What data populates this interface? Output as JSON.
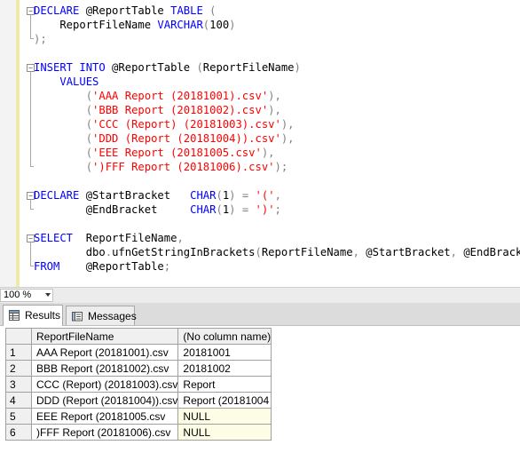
{
  "editor": {
    "lines": [
      [
        {
          "c": "kw",
          "t": "DECLARE"
        },
        {
          "c": "",
          "t": " @ReportTable "
        },
        {
          "c": "kw",
          "t": "TABLE"
        },
        {
          "c": "",
          "t": " "
        },
        {
          "c": "op",
          "t": "("
        }
      ],
      [
        {
          "c": "",
          "t": "    ReportFileName "
        },
        {
          "c": "kw",
          "t": "VARCHAR"
        },
        {
          "c": "op",
          "t": "("
        },
        {
          "c": "",
          "t": "100"
        },
        {
          "c": "op",
          "t": ")"
        }
      ],
      [
        {
          "c": "op",
          "t": ");"
        }
      ],
      [],
      [
        {
          "c": "kw",
          "t": "INSERT INTO"
        },
        {
          "c": "",
          "t": " @ReportTable "
        },
        {
          "c": "op",
          "t": "("
        },
        {
          "c": "",
          "t": "ReportFileName"
        },
        {
          "c": "op",
          "t": ")"
        }
      ],
      [
        {
          "c": "",
          "t": "    "
        },
        {
          "c": "kw",
          "t": "VALUES"
        }
      ],
      [
        {
          "c": "",
          "t": "        "
        },
        {
          "c": "op",
          "t": "("
        },
        {
          "c": "st",
          "t": "'AAA Report (20181001).csv'"
        },
        {
          "c": "op",
          "t": "),"
        }
      ],
      [
        {
          "c": "",
          "t": "        "
        },
        {
          "c": "op",
          "t": "("
        },
        {
          "c": "st",
          "t": "'BBB Report (20181002).csv'"
        },
        {
          "c": "op",
          "t": "),"
        }
      ],
      [
        {
          "c": "",
          "t": "        "
        },
        {
          "c": "op",
          "t": "("
        },
        {
          "c": "st",
          "t": "'CCC (Report) (20181003).csv'"
        },
        {
          "c": "op",
          "t": "),"
        }
      ],
      [
        {
          "c": "",
          "t": "        "
        },
        {
          "c": "op",
          "t": "("
        },
        {
          "c": "st",
          "t": "'DDD (Report (20181004)).csv'"
        },
        {
          "c": "op",
          "t": "),"
        }
      ],
      [
        {
          "c": "",
          "t": "        "
        },
        {
          "c": "op",
          "t": "("
        },
        {
          "c": "st",
          "t": "'EEE Report (20181005.csv'"
        },
        {
          "c": "op",
          "t": "),"
        }
      ],
      [
        {
          "c": "",
          "t": "        "
        },
        {
          "c": "op",
          "t": "("
        },
        {
          "c": "st",
          "t": "')FFF Report (20181006).csv'"
        },
        {
          "c": "op",
          "t": ");"
        }
      ],
      [],
      [
        {
          "c": "kw",
          "t": "DECLARE"
        },
        {
          "c": "",
          "t": " @StartBracket   "
        },
        {
          "c": "kw",
          "t": "CHAR"
        },
        {
          "c": "op",
          "t": "("
        },
        {
          "c": "",
          "t": "1"
        },
        {
          "c": "op",
          "t": ")"
        },
        {
          "c": "",
          "t": " "
        },
        {
          "c": "op",
          "t": "="
        },
        {
          "c": "",
          "t": " "
        },
        {
          "c": "st",
          "t": "'('"
        },
        {
          "c": "op",
          "t": ","
        }
      ],
      [
        {
          "c": "",
          "t": "        @EndBracket     "
        },
        {
          "c": "kw",
          "t": "CHAR"
        },
        {
          "c": "op",
          "t": "("
        },
        {
          "c": "",
          "t": "1"
        },
        {
          "c": "op",
          "t": ")"
        },
        {
          "c": "",
          "t": " "
        },
        {
          "c": "op",
          "t": "="
        },
        {
          "c": "",
          "t": " "
        },
        {
          "c": "st",
          "t": "')'"
        },
        {
          "c": "op",
          "t": ";"
        }
      ],
      [],
      [
        {
          "c": "kw",
          "t": "SELECT"
        },
        {
          "c": "",
          "t": "  ReportFileName"
        },
        {
          "c": "op",
          "t": ","
        }
      ],
      [
        {
          "c": "",
          "t": "        dbo"
        },
        {
          "c": "op",
          "t": "."
        },
        {
          "c": "",
          "t": "ufnGetStringInBrackets"
        },
        {
          "c": "op",
          "t": "("
        },
        {
          "c": "",
          "t": "ReportFileName"
        },
        {
          "c": "op",
          "t": ","
        },
        {
          "c": "",
          "t": " @StartBracket"
        },
        {
          "c": "op",
          "t": ","
        },
        {
          "c": "",
          "t": " @EndBracket"
        },
        {
          "c": "op",
          "t": ")"
        }
      ],
      [
        {
          "c": "kw",
          "t": "FROM"
        },
        {
          "c": "",
          "t": "    @ReportTable"
        },
        {
          "c": "op",
          "t": ";"
        }
      ]
    ]
  },
  "zoom": {
    "value": "100 %"
  },
  "tabs": [
    {
      "label": "Results"
    },
    {
      "label": "Messages"
    }
  ],
  "grid": {
    "headers": [
      "ReportFileName",
      "(No column name)"
    ],
    "rows": [
      {
        "num": "1",
        "file": "AAA Report (20181001).csv",
        "value": "20181001"
      },
      {
        "num": "2",
        "file": "BBB Report (20181002).csv",
        "value": "20181002"
      },
      {
        "num": "3",
        "file": "CCC (Report) (20181003).csv",
        "value": "Report"
      },
      {
        "num": "4",
        "file": "DDD (Report (20181004)).csv",
        "value": "Report (20181004"
      },
      {
        "num": "5",
        "file": "EEE Report (20181005.csv",
        "value": "NULL"
      },
      {
        "num": "6",
        "file": ")FFF Report (20181006).csv",
        "value": "NULL"
      }
    ]
  }
}
